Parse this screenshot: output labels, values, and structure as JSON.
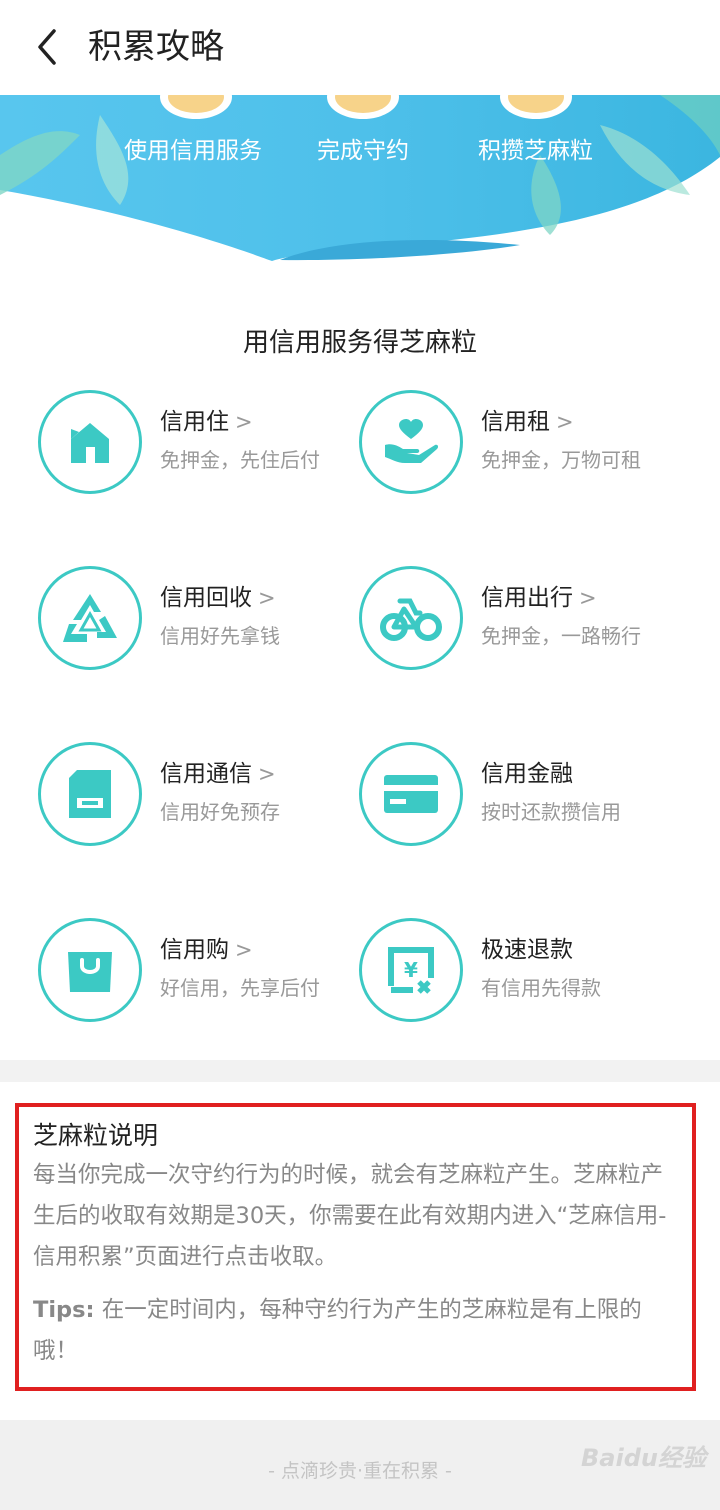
{
  "header": {
    "title": "积累攻略"
  },
  "banner": {
    "steps": [
      "使用信用服务",
      "完成守约",
      "积攒芝麻粒"
    ]
  },
  "services": {
    "title": "用信用服务得芝麻粒",
    "arrow": ">",
    "items": [
      {
        "name": "信用住",
        "desc": "免押金，先住后付",
        "icon": "house-icon"
      },
      {
        "name": "信用租",
        "desc": "免押金，万物可租",
        "icon": "heart-hand-icon"
      },
      {
        "name": "信用回收",
        "desc": "信用好先拿钱",
        "icon": "recycle-icon"
      },
      {
        "name": "信用出行",
        "desc": "免押金，一路畅行",
        "icon": "bicycle-icon"
      },
      {
        "name": "信用通信",
        "desc": "信用好免预存",
        "icon": "sim-card-icon"
      },
      {
        "name": "信用金融",
        "desc": "按时还款攒信用",
        "icon": "credit-card-icon"
      },
      {
        "name": "信用购",
        "desc": "好信用，先享后付",
        "icon": "shopping-bag-icon"
      },
      {
        "name": "极速退款",
        "desc": "有信用先得款",
        "icon": "refund-icon"
      }
    ]
  },
  "explanation": {
    "title": "芝麻粒说明",
    "body": "每当你完成一次守约行为的时候，就会有芝麻粒产生。芝麻粒产生后的收取有效期是30天，你需要在此有效期内进入“芝麻信用-信用积累”页面进行点击收取。",
    "tips_label": "Tips:",
    "tips_text": "在一定时间内，每种守约行为产生的芝麻粒是有上限的哦！"
  },
  "footer": {
    "slogan": "- 点滴珍贵·重在积累 -",
    "watermark": "Baidu经验"
  },
  "colors": {
    "accent": "#3cc9c4",
    "banner": "#4fc3e8",
    "highlight_border": "#e02020"
  }
}
